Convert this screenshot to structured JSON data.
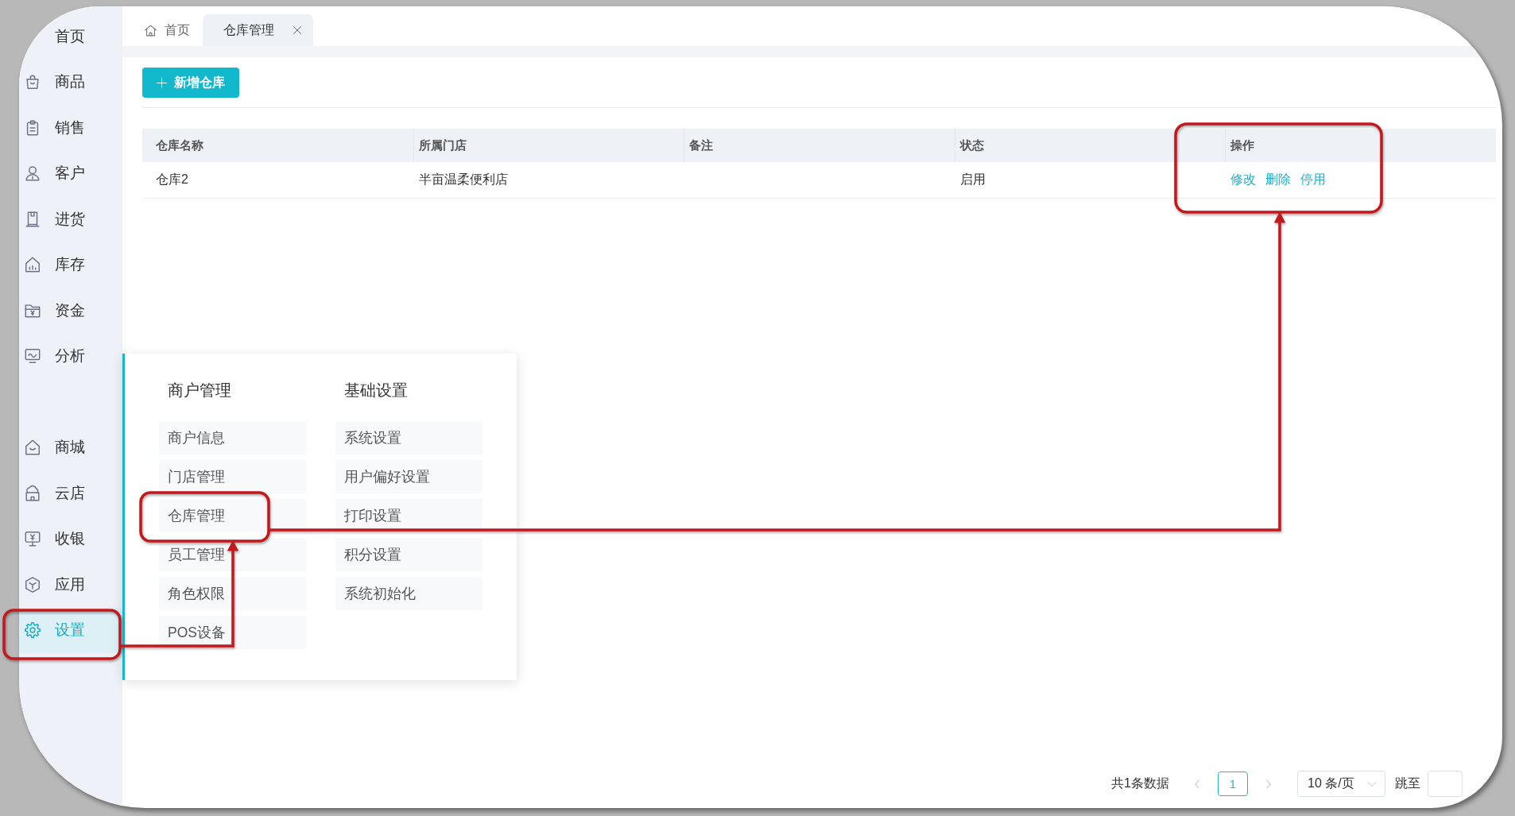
{
  "sidebar": {
    "groups": [
      {
        "items": [
          {
            "label": "首页",
            "selected": false
          },
          {
            "label": "商品",
            "selected": false
          },
          {
            "label": "销售",
            "selected": false
          },
          {
            "label": "客户",
            "selected": false
          },
          {
            "label": "进货",
            "selected": false
          },
          {
            "label": "库存",
            "selected": false
          },
          {
            "label": "资金",
            "selected": false
          },
          {
            "label": "分析",
            "selected": false
          }
        ]
      },
      {
        "items": [
          {
            "label": "商城",
            "selected": false
          },
          {
            "label": "云店",
            "selected": false
          },
          {
            "label": "收银",
            "selected": false
          },
          {
            "label": "应用",
            "selected": false
          },
          {
            "label": "设置",
            "selected": true
          }
        ]
      }
    ]
  },
  "tabs": [
    {
      "label": "首页",
      "selected": false,
      "closable": false
    },
    {
      "label": "仓库管理",
      "selected": true,
      "closable": true
    }
  ],
  "toolbar": {
    "add_button": "新增仓库"
  },
  "table": {
    "columns": [
      "仓库名称",
      "所属门店",
      "备注",
      "状态",
      "操作"
    ],
    "rows": [
      {
        "name": "仓库2",
        "store": "半亩温柔便利店",
        "status": "启用",
        "actions": [
          "修改",
          "删除",
          "停用"
        ]
      }
    ]
  },
  "flyout_menu": {
    "columns": [
      {
        "title": "商户管理",
        "items": [
          "商户信息",
          "门店管理",
          "仓库管理",
          "员工管理",
          "角色权限",
          "POS设备"
        ]
      },
      {
        "title": "基础设置",
        "items": [
          "系统设置",
          "用户偏好设置",
          "打印设置",
          "积分设置",
          "系统初始化"
        ]
      }
    ]
  },
  "pagination": {
    "total": "共1条数据",
    "pages": [
      {
        "label": "1",
        "selected": true
      }
    ],
    "page_size": "10 条/页",
    "jump_label": "跳至"
  }
}
